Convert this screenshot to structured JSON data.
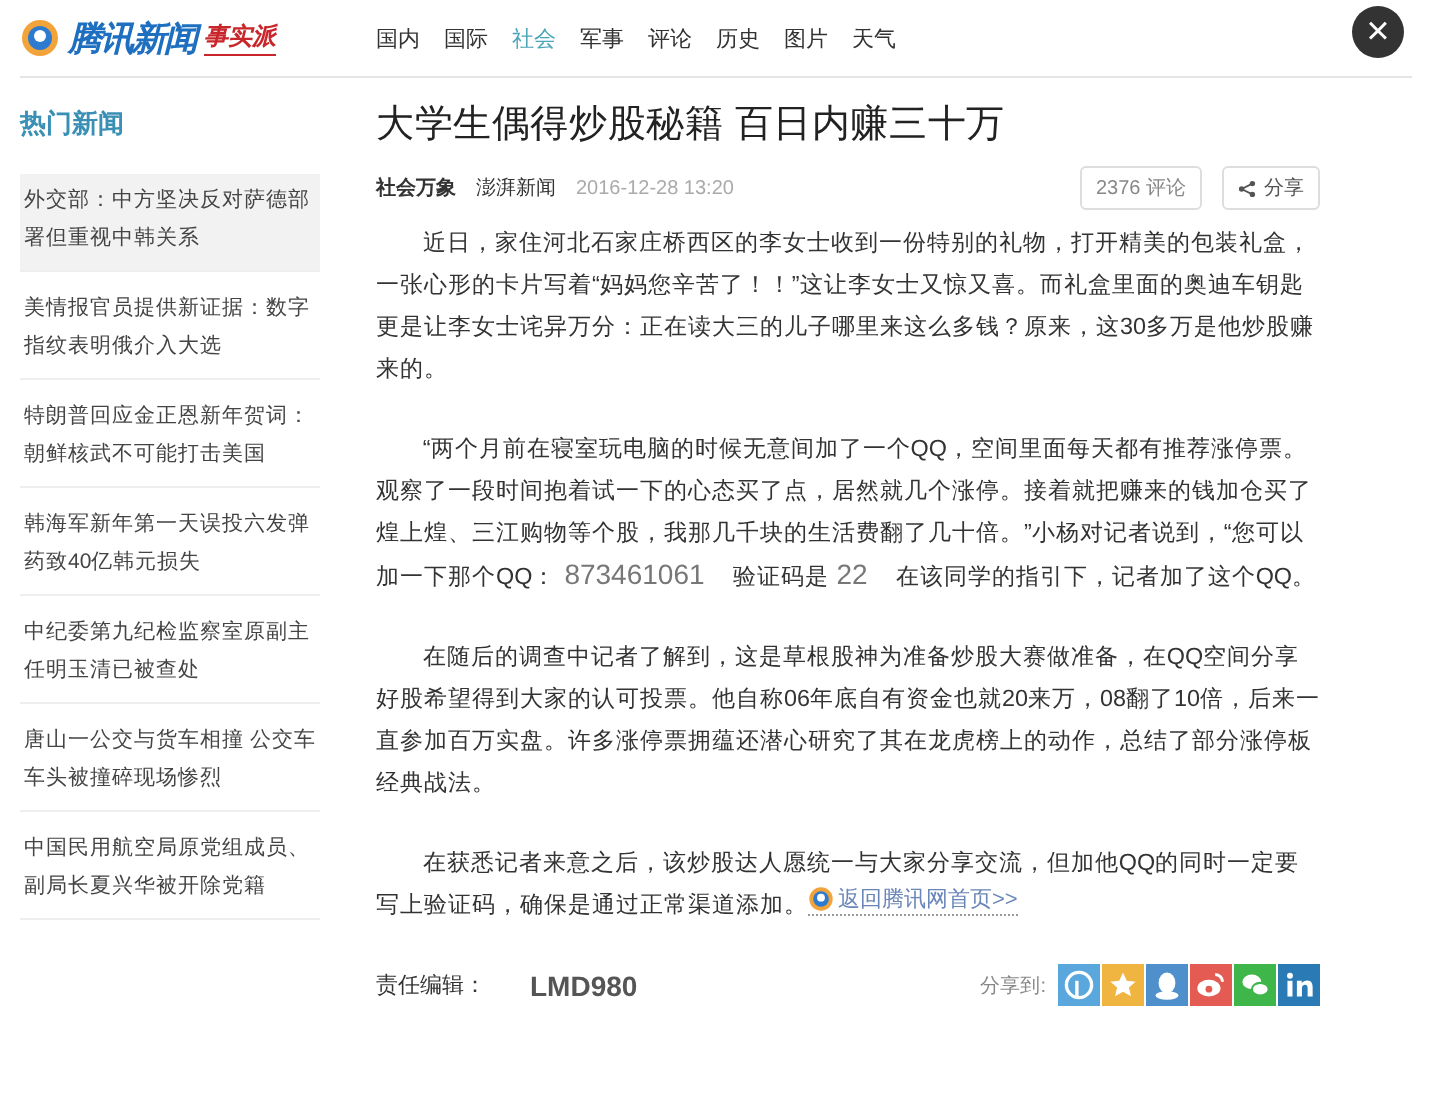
{
  "header": {
    "logo_text": "腾讯新闻",
    "logo_badge": "事实派",
    "nav": [
      {
        "label": "国内",
        "selected": false
      },
      {
        "label": "国际",
        "selected": false
      },
      {
        "label": "社会",
        "selected": true
      },
      {
        "label": "军事",
        "selected": false
      },
      {
        "label": "评论",
        "selected": false
      },
      {
        "label": "历史",
        "selected": false
      },
      {
        "label": "图片",
        "selected": false
      },
      {
        "label": "天气",
        "selected": false
      }
    ],
    "close_label": "×"
  },
  "sidebar": {
    "title": "热门新闻",
    "items": [
      {
        "text": "外交部：中方坚决反对萨德部署但重视中韩关系",
        "selected": true
      },
      {
        "text": "美情报官员提供新证据：数字指纹表明俄介入大选",
        "selected": false
      },
      {
        "text": "特朗普回应金正恩新年贺词：朝鲜核武不可能打击美国",
        "selected": false
      },
      {
        "text": "韩海军新年第一天误投六发弹药致40亿韩元损失",
        "selected": false
      },
      {
        "text": "中纪委第九纪检监察室原副主任明玉清已被查处",
        "selected": false
      },
      {
        "text": "唐山一公交与货车相撞 公交车车头被撞碎现场惨烈",
        "selected": false
      },
      {
        "text": "中国民用航空局原党组成员、副局长夏兴华被开除党籍",
        "selected": false
      }
    ]
  },
  "article": {
    "title": "大学生偶得炒股秘籍 百日内赚三十万",
    "category": "社会万象",
    "source": "澎湃新闻",
    "time": "2016-12-28 13:20",
    "comments": "2376 评论",
    "share_button": "分享",
    "paragraphs": [
      [
        {
          "kind": "text",
          "text": "近日，家住河北石家庄桥西区的李女士收到一份特别的礼物，打开精美的包装礼盒，一张心形的卡片写着“妈妈您辛苦了！！”这让李女士又惊又喜。而礼盒里面的奥迪车钥匙更是让李女士诧异万分：正在读大三的儿子哪里来这么多钱？原来，这30多万是他炒股赚来的。"
        }
      ],
      [
        {
          "kind": "text",
          "text": "“两个月前在寝室玩电脑的时候无意间加了一个QQ，空间里面每天都有推荐涨停票。观察了一段时间抱着试一下的心态买了点，居然就几个涨停。接着就把赚来的钱加仓买了煌上煌、三江购物等个股，我那几千块的生活费翻了几十倍。”小杨对记者说到，“您可以加一下那个QQ："
        },
        {
          "kind": "inserted",
          "text": "873461061"
        },
        {
          "kind": "text",
          "text": "验证码是"
        },
        {
          "kind": "inserted",
          "text": "22"
        },
        {
          "kind": "text",
          "text": "在该同学的指引下，记者加了这个QQ。"
        }
      ],
      [
        {
          "kind": "text",
          "text": "在随后的调查中记者了解到，这是草根股神为准备炒股大赛做准备，在QQ空间分享好股希望得到大家的认可投票。他自称06年底自有资金也就20来万，08翻了10倍，后来一直参加百万实盘。许多涨停票拥蕴还潜心研究了其在龙虎榜上的动作，总结了部分涨停板经典战法。"
        }
      ],
      [
        {
          "kind": "text",
          "text": "在获悉记者来意之后，该炒股达人愿统一与大家分享交流，但加他QQ的同时一定要写上验证码，确保是通过正常渠道添加。"
        },
        {
          "kind": "link",
          "text": "返回腾讯网首页>>"
        }
      ]
    ],
    "editor_label": "责任编辑：",
    "editor": "LMD980",
    "share_label": "分享到:",
    "share_icons": [
      {
        "kind": "qzone",
        "color": "#5aa7dd"
      },
      {
        "kind": "star",
        "color": "#f0b540"
      },
      {
        "kind": "qq",
        "color": "#4e8fcc"
      },
      {
        "kind": "weibo",
        "color": "#e35b52"
      },
      {
        "kind": "wechat",
        "color": "#3fb649"
      },
      {
        "kind": "linkedin",
        "color": "#2a7ab5"
      }
    ]
  }
}
